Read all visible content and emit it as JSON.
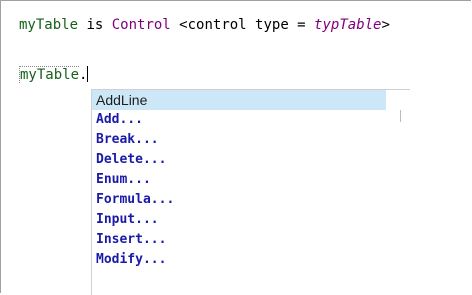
{
  "editor": {
    "line1": {
      "ident": "myTable",
      "is_kw": " is ",
      "control_word": "Control",
      "rest": " <control type = ",
      "type_name": "typTable",
      "close": ">"
    },
    "line2": {
      "ident": "myTable",
      "dot": "."
    }
  },
  "autocomplete": {
    "selected_index": 0,
    "items": [
      "AddLine",
      "Add...",
      "Break...",
      "Delete...",
      "Enum...",
      "Formula...",
      "Input...",
      "Insert...",
      "Modify..."
    ]
  },
  "colors": {
    "identifier": "#15601a",
    "control_keyword": "#800080",
    "list_item": "#1a1aa8",
    "selection": "#cce8f8"
  }
}
